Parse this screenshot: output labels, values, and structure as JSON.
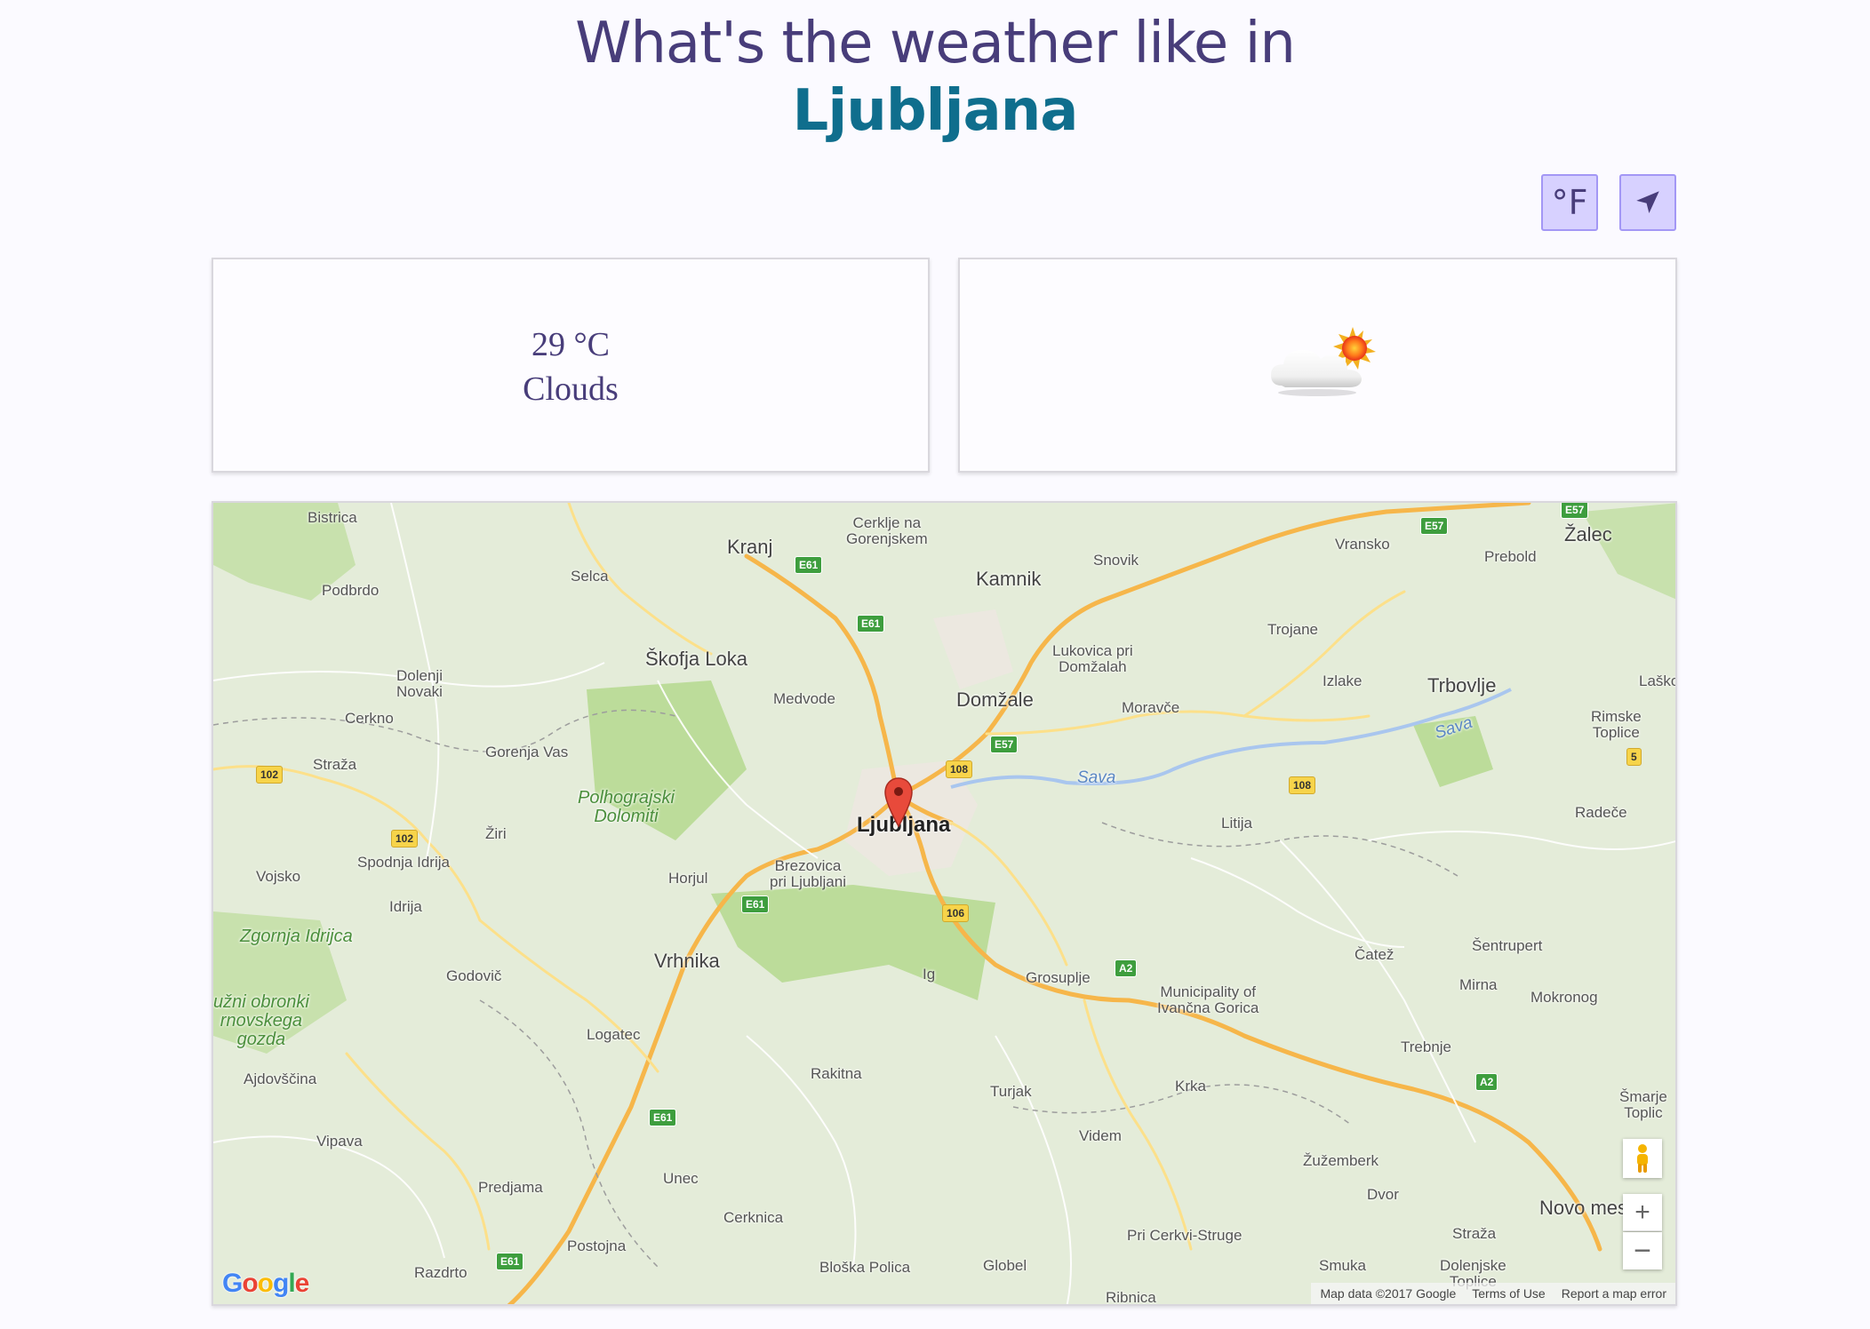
{
  "header": {
    "line1": "What's the weather like in",
    "city": "Ljubljana"
  },
  "toolbar": {
    "unit_toggle_label": "°F",
    "locate_icon": "navigation-arrow-icon"
  },
  "weather": {
    "temperature": "29 °C",
    "condition": "Clouds",
    "icon": "cloud-sun-icon"
  },
  "map": {
    "marker_city": "Ljubljana",
    "labels": {
      "bistrica": "Bistrica",
      "kranj": "Kranj",
      "cerklje": "Cerklje na\nGorenjskem",
      "snovik": "Snovik",
      "vransko": "Vransko",
      "zalec": "Žalec",
      "prebold": "Prebold",
      "podbrdo": "Podbrdo",
      "selca": "Selca",
      "kamnik": "Kamnik",
      "trojane": "Trojane",
      "skofja_loka": "Škofja Loka",
      "lukovica": "Lukovica pri\nDomžalah",
      "izlake": "Izlake",
      "trbovlje": "Trbovlje",
      "lasko": "Laško",
      "dolenji_novaki": "Dolenji\nNovaki",
      "medvode": "Medvode",
      "domzale": "Domžale",
      "moravce": "Moravče",
      "cerkno": "Cerkno",
      "rimske_toplice": "Rimske\nToplice",
      "straza_w": "Straža",
      "gorenja_vas": "Gorenja Vas",
      "polhograjski": "Polhograjski\nDolomiti",
      "sava1": "Sava",
      "sava2": "Sava",
      "ziri": "Žiri",
      "litija": "Litija",
      "radece": "Radeče",
      "vojsko": "Vojsko",
      "spodnja_idrija": "Spodnja Idrija",
      "horjul": "Horjul",
      "brezovica": "Brezovica\npri Ljubljani",
      "idrija": "Idrija",
      "zgornja_idrijca": "Zgornja Idrijca",
      "sentrupert": "Šentrupert",
      "vrhnika": "Vrhnika",
      "catez": "Čatež",
      "godovic": "Godovič",
      "ig": "Ig",
      "grosuplje": "Grosuplje",
      "mirna": "Mirna",
      "municipality": "Municipality of\nIvančna Gorica",
      "mokronog": "Mokronog",
      "juzni": "užni obronki\nrnovskega\ngozda",
      "logatec": "Logatec",
      "trebnje": "Trebnje",
      "rakitna": "Rakitna",
      "ajdovscina": "Ajdovščina",
      "turjak": "Turjak",
      "krka": "Krka",
      "smarjes": "Šmarje\nToplic",
      "vipava": "Vipava",
      "videm": "Videm",
      "zuzemberk": "Žužemberk",
      "unec": "Unec",
      "predjama": "Predjama",
      "dvor": "Dvor",
      "novo_mesto": "Novo mes",
      "cerknica": "Cerknica",
      "pri_cerkvi": "Pri Cerkvi-Struge",
      "straza_e": "Straža",
      "postojna": "Postojna",
      "razdrto": "Razdrto",
      "bloska": "Bloška Polica",
      "globel": "Globel",
      "smuka": "Smuka",
      "dolenjske": "Dolenjske\nToplice",
      "ribnica": "Ribnica"
    },
    "shields": {
      "e61_a": "E61",
      "e61_b": "E61",
      "e61_c": "E61",
      "e61_d": "E61",
      "e61_e": "E61",
      "e57_a": "E57",
      "e57_b": "E57",
      "e57_c": "E57",
      "r102_a": "102",
      "r102_b": "102",
      "r108_a": "108",
      "r108_b": "108",
      "r106": "106",
      "a2_a": "A2",
      "a2_b": "A2",
      "r5": "5"
    },
    "controls": {
      "pegman_icon": "pegman-icon",
      "zoom_in": "+",
      "zoom_out": "−"
    },
    "attribution": {
      "data": "Map data ©2017 Google",
      "terms": "Terms of Use",
      "report": "Report a map error"
    },
    "logo": "Google"
  },
  "colors": {
    "heading": "#483d7a",
    "city": "#0f6e8d",
    "button_bg": "#d7d1ff",
    "button_border": "#a397f5"
  }
}
